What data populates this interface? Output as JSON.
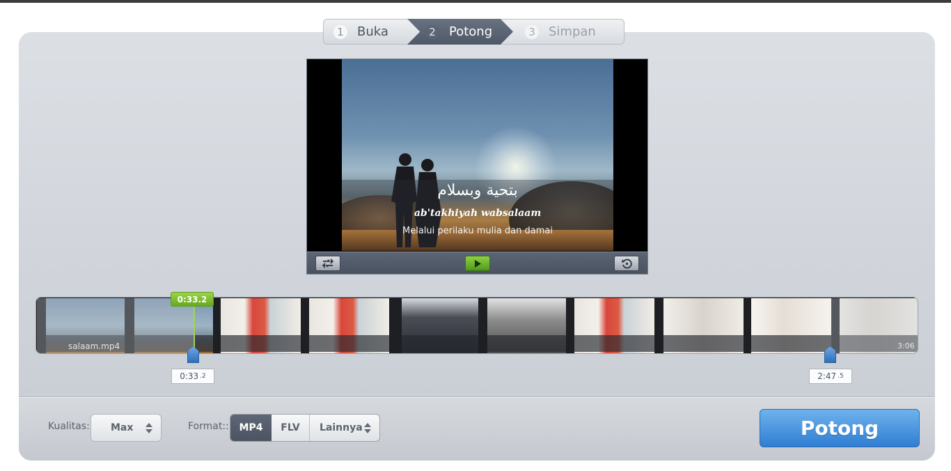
{
  "steps": [
    {
      "num": "1",
      "label": "Buka"
    },
    {
      "num": "2",
      "label": "Potong"
    },
    {
      "num": "3",
      "label": "Simpan"
    }
  ],
  "video": {
    "arabic_text": "بتحية وبسلام",
    "latin_text": "ab'takhiyah wabsalaam",
    "subtitle": "Melalui perilaku mulia dan damai",
    "icons": {
      "shuffle": "shuffle-icon",
      "play": "play-icon",
      "replay": "replay-icon"
    }
  },
  "timeline": {
    "file_name": "salaam.mp4",
    "duration": "3:06",
    "selected_start_badge": "0:33.2",
    "start": {
      "main": "0:33",
      "frac": ".2"
    },
    "end": {
      "main": "2:47",
      "frac": ".5"
    },
    "selection_start_sec": 33.2,
    "selection_end_sec": 167.5,
    "total_sec": 186
  },
  "settings": {
    "quality_label": "Kualitas:",
    "quality_value": "Max",
    "format_label": "Format::",
    "formats": [
      "MP4",
      "FLV",
      "Lainnya"
    ],
    "selected_format": "MP4"
  },
  "action": {
    "label": "Potong"
  }
}
